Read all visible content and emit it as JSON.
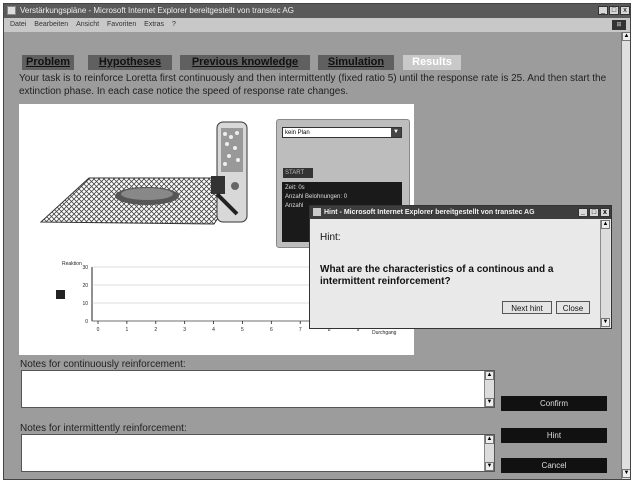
{
  "window": {
    "title": "Verstärkungspläne - Microsoft Internet Explorer bereitgestellt von transtec AG",
    "controls": [
      "_",
      "□",
      "x"
    ]
  },
  "menubar": {
    "items": [
      "Datei",
      "Bearbeiten",
      "Ansicht",
      "Favoriten",
      "Extras",
      "?"
    ]
  },
  "tabs": [
    {
      "label": "Problem"
    },
    {
      "label": "Hypotheses"
    },
    {
      "label": "Previous knowledge"
    },
    {
      "label": "Simulation"
    },
    {
      "label": "Results"
    }
  ],
  "task_text": "Your task is to reinforce Loretta first continuously and then intermittently (fixed ratio 5) until the response rate is 25. And then start the extinction phase. In each case notice the speed of response rate changes.",
  "simulation": {
    "plan_select": "kein Plan",
    "start_label": "START",
    "info_lines": [
      "Zeit: 0s",
      "Anzahl Belohnungen: 0",
      "Anzahl"
    ]
  },
  "chart_data": {
    "type": "line",
    "ylabel": "Reaktion",
    "xlabel": "Durchgang",
    "yticks": [
      "30",
      "20",
      "10",
      "0"
    ],
    "xticks": [
      "0",
      "1",
      "2",
      "3",
      "4",
      "5",
      "6",
      "7",
      "8",
      "9"
    ],
    "series": []
  },
  "hint_dialog": {
    "title": "Hint - Microsoft Internet Explorer bereitgestellt von transtec AG",
    "heading": "Hint:",
    "question": "What are the characteristics of a continous and a intermittent reinforcement?",
    "next_hint_label": "Next hint",
    "close_label": "Close"
  },
  "notes": {
    "continuous_label": "Notes for continuously reinforcement:",
    "intermittent_label": "Notes for intermittently reinforcement:"
  },
  "buttons": {
    "confirm": "Confirm",
    "hint": "Hint",
    "cancel": "Cancel"
  },
  "colors": {
    "background": "#9c9c9c",
    "dark_button": "#111111",
    "active_tab": "#c9c9c9"
  }
}
